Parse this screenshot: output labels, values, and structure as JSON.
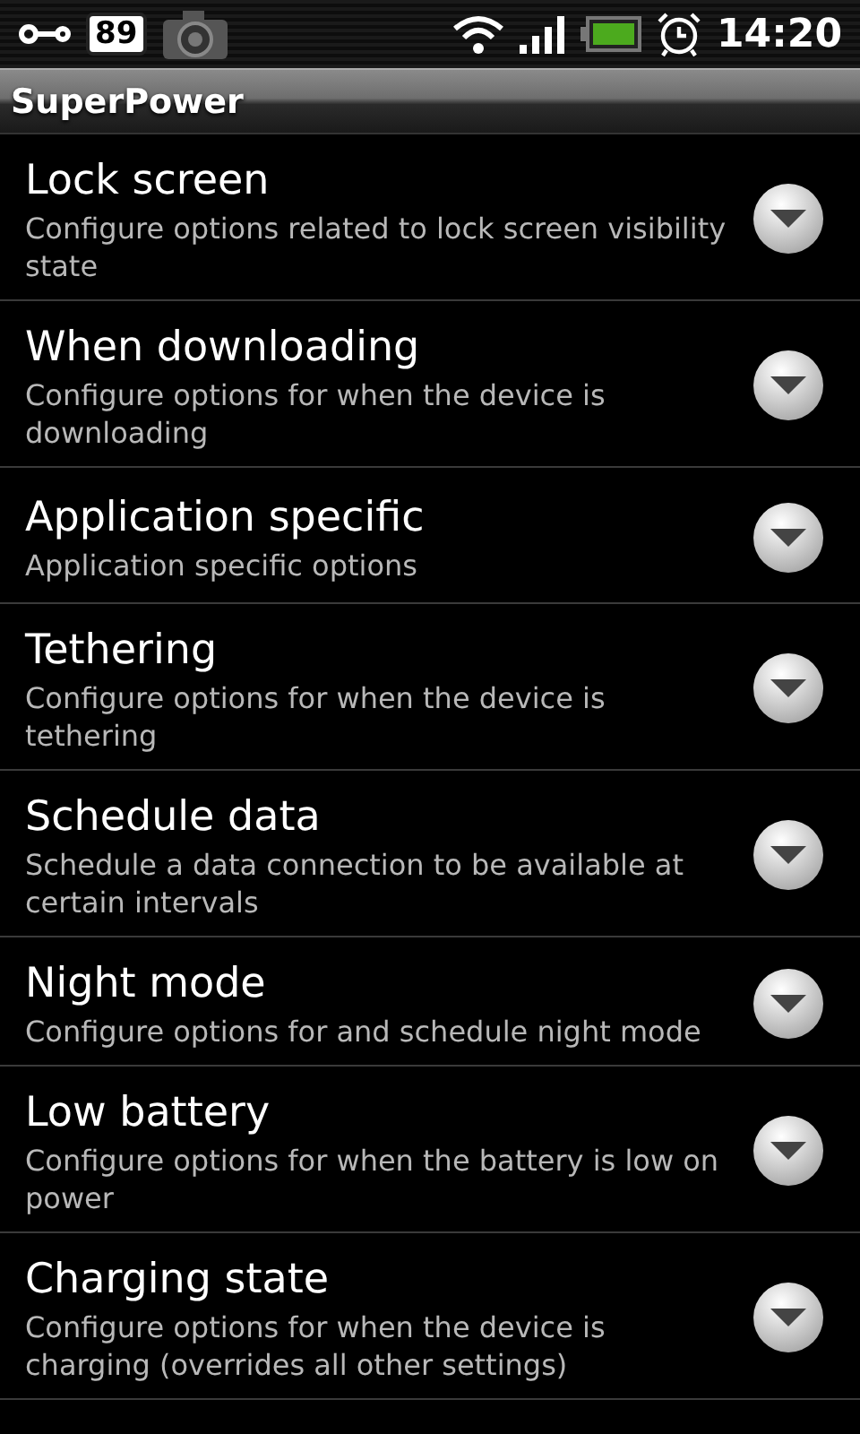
{
  "status_bar": {
    "notification_count": "89",
    "time": "14:20"
  },
  "app_bar": {
    "title": "SuperPower"
  },
  "items": [
    {
      "title": "Lock screen",
      "summary": "Configure options related to lock screen visibility state"
    },
    {
      "title": "When downloading",
      "summary": "Configure options for when the device is downloading"
    },
    {
      "title": "Application specific",
      "summary": "Application specific options"
    },
    {
      "title": "Tethering",
      "summary": "Configure options for when the device is tethering"
    },
    {
      "title": "Schedule data",
      "summary": "Schedule a data connection to be available at certain intervals"
    },
    {
      "title": "Night mode",
      "summary": "Configure options for and schedule night mode"
    },
    {
      "title": "Low battery",
      "summary": "Configure options for when the battery is low on power"
    },
    {
      "title": "Charging state",
      "summary": "Configure options for when the device is charging (overrides all other settings)"
    }
  ]
}
